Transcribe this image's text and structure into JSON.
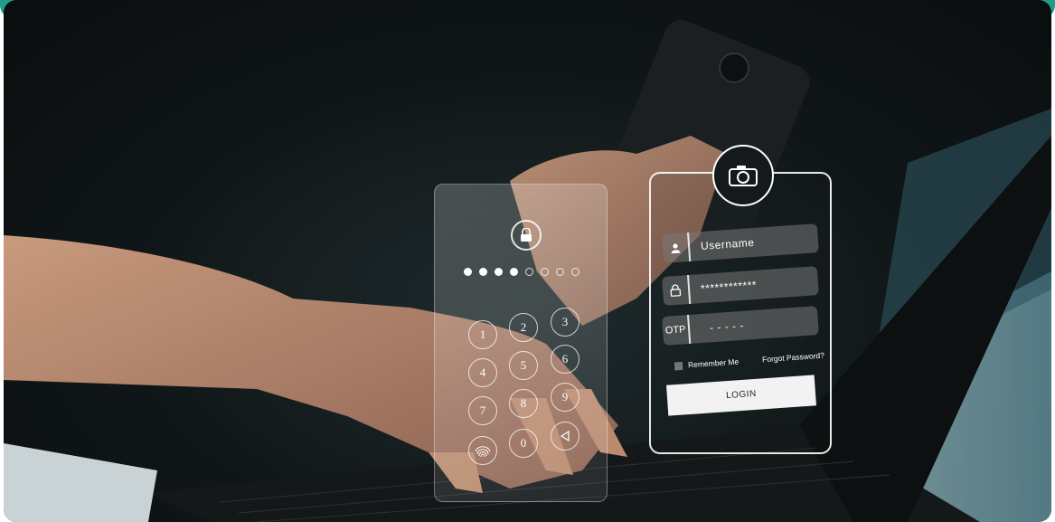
{
  "login": {
    "username_placeholder": "Username",
    "password_mask": "************",
    "otp_label": "OTP",
    "otp_mask": "- - - - -",
    "remember_label": "Remember Me",
    "forgot_label": "Forgot Password?",
    "button_label": "LOGIN"
  },
  "keypad": {
    "keys": [
      "1",
      "2",
      "3",
      "4",
      "5",
      "6",
      "7",
      "8",
      "9",
      "0"
    ],
    "pin_filled": 4,
    "pin_total": 8
  },
  "colors": {
    "accent_bar": "#1f9e8a"
  },
  "icons": [
    "camera-icon",
    "padlock-icon",
    "user-icon",
    "fingerprint-icon",
    "back-triangle-icon"
  ]
}
